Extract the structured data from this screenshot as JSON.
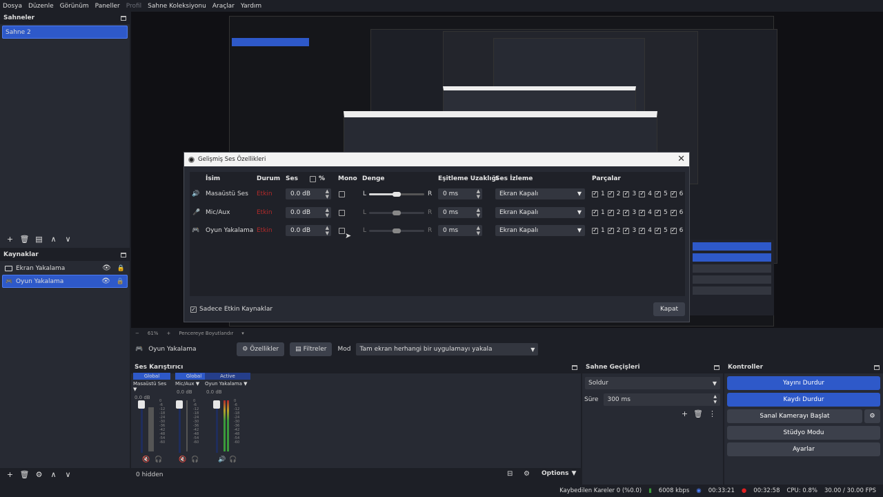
{
  "menu": [
    "Dosya",
    "Düzenle",
    "Görünüm",
    "Paneller",
    "Profil",
    "Sahne Koleksiyonu",
    "Araçlar",
    "Yardım"
  ],
  "scenes": {
    "title": "Sahneler",
    "items": [
      "Sahne 2"
    ]
  },
  "sources": {
    "title": "Kaynaklar",
    "items": [
      "Ekran Yakalama",
      "Oyun Yakalama"
    ]
  },
  "preview_bar": {
    "zoom": "61%",
    "resize": "Pencereye Boyutlandır"
  },
  "dialog": {
    "title": "Gelişmiş Ses Özellikleri",
    "headers": {
      "name": "İsim",
      "status": "Durum",
      "volume": "Ses",
      "percent": "%",
      "mono": "Mono",
      "balance": "Denge",
      "sync": "Eşitleme Uzaklığı",
      "monitor": "Ses İzleme",
      "tracks": "Parçalar"
    },
    "rows": [
      {
        "name": "Masaüstü Ses",
        "status": "Etkin",
        "volume": "0.0 dB",
        "sync": "0 ms",
        "monitor": "Ekran Kapalı"
      },
      {
        "name": "Mic/Aux",
        "status": "Etkin",
        "volume": "0.0 dB",
        "sync": "0 ms",
        "monitor": "Ekran Kapalı"
      },
      {
        "name": "Oyun Yakalama",
        "status": "Etkin",
        "volume": "0.0 dB",
        "sync": "0 ms",
        "monitor": "Ekran Kapalı"
      }
    ],
    "balance_left": "L",
    "balance_right": "R",
    "track_numbers": [
      "1",
      "2",
      "3",
      "4",
      "5",
      "6"
    ],
    "only_active": "Sadece Etkin Kaynaklar",
    "close": "Kapat"
  },
  "source_bar": {
    "name": "Oyun Yakalama",
    "properties": "Özellikler",
    "filters": "Filtreler",
    "mode_label": "Mod",
    "mode_value": "Tam ekran herhangi bir uygulamayı yakala"
  },
  "mixer": {
    "title": "Ses Karıştırıcı",
    "channels": [
      {
        "tag": "Global",
        "name": "Masaüstü Ses",
        "db": "0.0 dB"
      },
      {
        "tag": "Global",
        "name": "Mic/Aux",
        "db": "0.0 dB"
      },
      {
        "tag": "Active",
        "name": "Oyun Yakalama",
        "db": "0.0 dB"
      }
    ],
    "scale": [
      "0",
      "-6",
      "-12",
      "-18",
      "-24",
      "-30",
      "-36",
      "-42",
      "-48",
      "-54",
      "-60"
    ],
    "hidden": "0 hidden",
    "options": "Options"
  },
  "transitions": {
    "title": "Sahne Geçişleri",
    "value": "Soldur",
    "duration_label": "Süre",
    "duration": "300 ms"
  },
  "controls": {
    "title": "Kontroller",
    "stop_stream": "Yayını Durdur",
    "stop_rec": "Kaydı Durdur",
    "virtual_cam": "Sanal Kamerayı Başlat",
    "studio": "Stüdyo Modu",
    "settings": "Ayarlar"
  },
  "status": {
    "dropped": "Kaybedilen Kareler 0 (%0.0)",
    "kbps": "6008 kbps",
    "stream_time": "00:33:21",
    "rec_time": "00:32:58",
    "cpu": "CPU: 0.8%",
    "fps": "30.00 / 30.00 FPS"
  },
  "colors": {
    "accent": "#2e59c9",
    "inactive_red": "#b42a2a"
  }
}
